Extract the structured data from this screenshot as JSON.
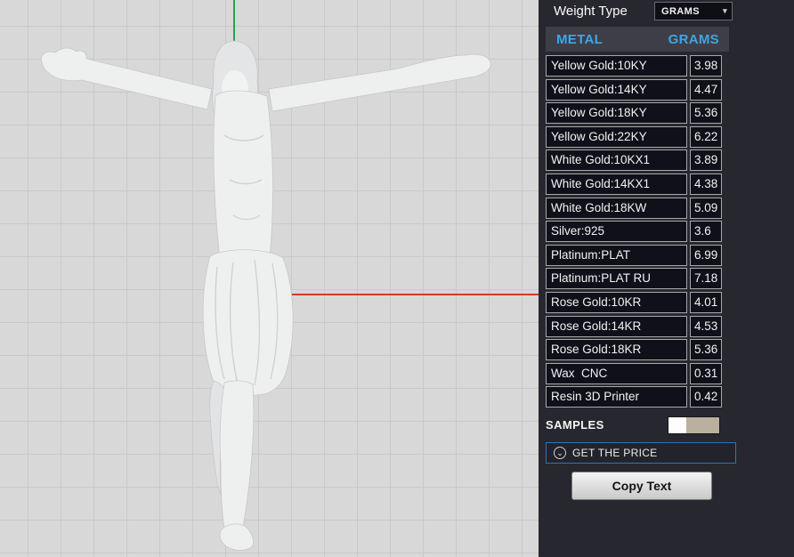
{
  "panel": {
    "weight_type": {
      "label": "Weight Type",
      "value": "GRAMS"
    },
    "table": {
      "header": {
        "metal": "METAL",
        "grams": "GRAMS"
      },
      "rows": [
        {
          "metal": "Yellow Gold:10KY",
          "grams": "3.98"
        },
        {
          "metal": "Yellow Gold:14KY",
          "grams": "4.47"
        },
        {
          "metal": "Yellow Gold:18KY",
          "grams": "5.36"
        },
        {
          "metal": "Yellow Gold:22KY",
          "grams": "6.22"
        },
        {
          "metal": "White Gold:10KX1",
          "grams": "3.89"
        },
        {
          "metal": "White Gold:14KX1",
          "grams": "4.38"
        },
        {
          "metal": "White Gold:18KW",
          "grams": "5.09"
        },
        {
          "metal": "Silver:925",
          "grams": "3.6"
        },
        {
          "metal": "Platinum:PLAT",
          "grams": "6.99"
        },
        {
          "metal": "Platinum:PLAT RU",
          "grams": "7.18"
        },
        {
          "metal": "Rose Gold:10KR",
          "grams": "4.01"
        },
        {
          "metal": "Rose Gold:14KR",
          "grams": "4.53"
        },
        {
          "metal": "Rose Gold:18KR",
          "grams": "5.36"
        },
        {
          "metal": "Wax  CNC",
          "grams": "0.31"
        },
        {
          "metal": "Resin 3D Printer",
          "grams": "0.42"
        }
      ]
    },
    "samples": {
      "label": "SAMPLES"
    },
    "get_price": {
      "label": "GET THE PRICE"
    },
    "copy_button": {
      "label": "Copy Text"
    }
  },
  "colors": {
    "axis_green": "#2f9e4f",
    "axis_red": "#d43a26",
    "header_text": "#41a4e4",
    "price_border": "#2e75b5",
    "swatch_tan": "#b9b09e",
    "panel_bg": "#27272f",
    "cell_bg": "#10101a"
  }
}
